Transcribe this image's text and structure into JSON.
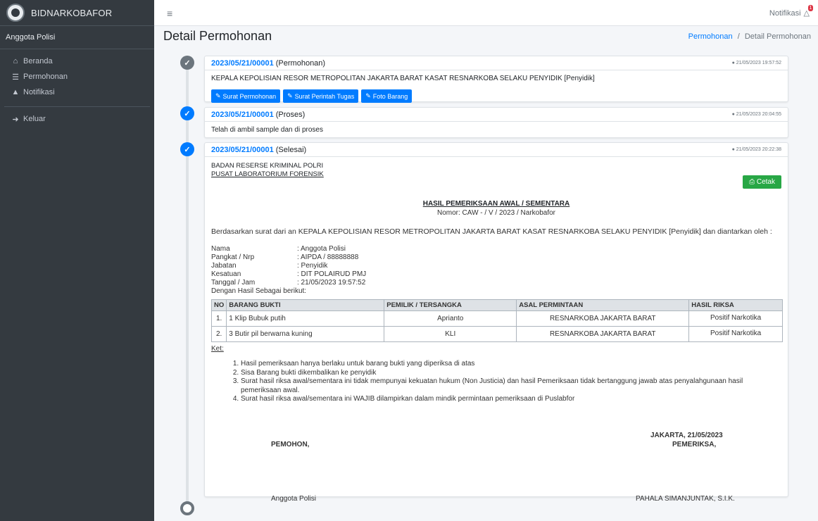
{
  "brand": {
    "name": "BIDNARKOBAFOR"
  },
  "user": {
    "name": "Anggota Polisi"
  },
  "sidebar": {
    "items": [
      {
        "label": "Beranda",
        "icon": "home-icon"
      },
      {
        "label": "Permohonan",
        "icon": "list-icon"
      },
      {
        "label": "Notifikasi",
        "icon": "bell-icon"
      }
    ],
    "logout": {
      "label": "Keluar",
      "icon": "sign-out-icon"
    }
  },
  "topbar": {
    "notif_label": "Notifikasi",
    "notif_count": "1"
  },
  "page": {
    "title": "Detail Permohonan",
    "breadcrumb": {
      "link": "Permohonan",
      "sep": "/",
      "current": "Detail Permohonan"
    }
  },
  "timeline": [
    {
      "id": "2023/05/21/00001",
      "status": "(Permohonan)",
      "time": "21/05/2023 19:57:52",
      "body": "KEPALA KEPOLISIAN RESOR METROPOLITAN JAKARTA BARAT KASAT RESNARKOBA SELAKU PENYIDIK [Penyidik]",
      "buttons": [
        "Surat Permohonan",
        "Surat Perintah Tugas",
        "Foto Barang"
      ]
    },
    {
      "id": "2023/05/21/00001",
      "status": "(Proses)",
      "time": "21/05/2023 20:04:55",
      "body": "Telah di ambil sample dan di proses"
    },
    {
      "id": "2023/05/21/00001",
      "status": "(Selesai)",
      "time": "21/05/2023 20:22:38"
    }
  ],
  "report": {
    "inst_line1": "BADAN RESERSE KRIMINAL POLRI",
    "inst_line2": "PUSAT LABORATORIUM FORENSIK",
    "print_label": "Cetak",
    "title": "HASIL PEMERIKSAAN AWAL / SEMENTARA",
    "number": "Nomor: CAW -    / V / 2023 / Narkobafor",
    "intro": "Berdasarkan surat dari an KEPALA KEPOLISIAN RESOR METROPOLITAN JAKARTA BARAT KASAT RESNARKOBA SELAKU PENYIDIK [Penyidik] dan diantarkan oleh  :",
    "fields": [
      {
        "k": "Nama",
        "v": ":  Anggota Polisi"
      },
      {
        "k": "Pangkat / Nrp",
        "v": ":  AIPDA / 88888888"
      },
      {
        "k": "Jabatan",
        "v": ":  Penyidik"
      },
      {
        "k": "Kesatuan",
        "v": ":  DIT POLAIRUD PMJ"
      },
      {
        "k": "Tanggal / Jam",
        "v": ":  21/05/2023 19:57:52"
      }
    ],
    "hasil_label": "Dengan Hasil Sebagai berikut:",
    "table": {
      "headers": [
        "NO",
        "BARANG BUKTI",
        "PEMILIK / TERSANGKA",
        "ASAL PERMINTAAN",
        "HASIL RIKSA"
      ],
      "rows": [
        [
          "1.",
          "1 Klip Bubuk putih",
          "Aprianto",
          "RESNARKOBA JAKARTA BARAT",
          "Positif Narkotika"
        ],
        [
          "2.",
          "3 Butir pil berwarna kuning",
          "KLI",
          "RESNARKOBA JAKARTA BARAT",
          "Positif Narkotika"
        ]
      ]
    },
    "ket_label": "Ket:",
    "notes": [
      "Hasil pemeriksaan hanya berlaku untuk barang bukti yang diperiksa di atas",
      "Sisa Barang bukti dikembalikan ke penyidik",
      "Surat hasil riksa awal/sementara ini tidak mempunyai kekuatan hukum (Non Justicia) dan hasil Pemeriksaan tidak bertanggung jawab atas penyalahgunaan hasil pemeriksaan awal.",
      "Surat hasil riksa awal/sementara ini WAJIB dilampirkan dalam mindik permintaan pemeriksaan di Puslabfor"
    ],
    "place_date": "JAKARTA, 21/05/2023",
    "left_sign_title": "PEMOHON,",
    "right_sign_title": "PEMERIKSA,",
    "left_sign_name": "Anggota Polisi",
    "right_sign_name": "PAHALA SIMANJUNTAK, S.I.K."
  }
}
